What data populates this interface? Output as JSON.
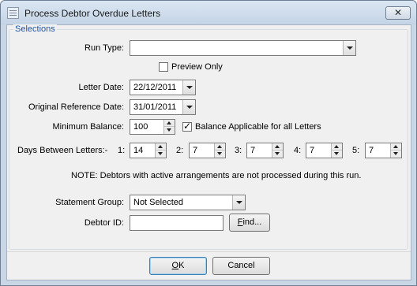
{
  "window": {
    "title": "Process Debtor Overdue Letters",
    "close_glyph": "✕"
  },
  "selections": {
    "group_label": "Selections",
    "run_type": {
      "label": "Run Type:",
      "value": ""
    },
    "preview_only": {
      "label": "Preview Only",
      "checked": false
    },
    "letter_date": {
      "label": "Letter Date:",
      "value": "22/12/2011"
    },
    "original_reference_date": {
      "label": "Original Reference Date:",
      "value": "31/01/2011"
    },
    "minimum_balance": {
      "label": "Minimum Balance:",
      "value": "100"
    },
    "balance_applicable": {
      "label": "Balance Applicable for all Letters",
      "checked": true,
      "tick": "✓"
    },
    "days_between": {
      "label": "Days Between Letters:-",
      "items": [
        {
          "label": "1:",
          "value": "14"
        },
        {
          "label": "2:",
          "value": "7"
        },
        {
          "label": "3:",
          "value": "7"
        },
        {
          "label": "4:",
          "value": "7"
        },
        {
          "label": "5:",
          "value": "7"
        }
      ]
    },
    "note": "NOTE:  Debtors with active arrangements are not processed during this run.",
    "statement_group": {
      "label": "Statement Group:",
      "value": "Not Selected"
    },
    "debtor_id": {
      "label": "Debtor ID:",
      "value": "",
      "find_prefix": "F",
      "find_suffix": "ind..."
    }
  },
  "buttons": {
    "ok_accel": "O",
    "ok_rest": "K",
    "cancel": "Cancel"
  }
}
